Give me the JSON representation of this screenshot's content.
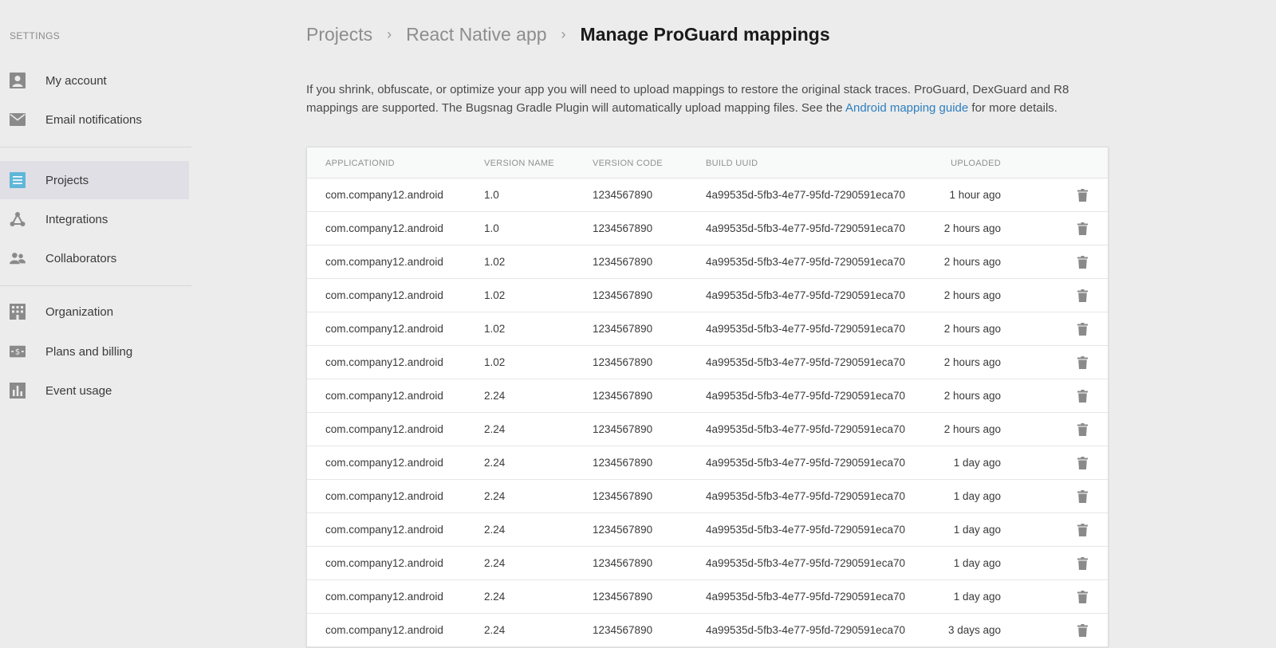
{
  "sidebar": {
    "heading": "SETTINGS",
    "items": [
      {
        "label": "My account",
        "icon": "person-icon"
      },
      {
        "label": "Email notifications",
        "icon": "envelope-icon"
      },
      {
        "label": "Projects",
        "icon": "list-icon",
        "active": true
      },
      {
        "label": "Integrations",
        "icon": "network-icon"
      },
      {
        "label": "Collaborators",
        "icon": "people-icon"
      },
      {
        "label": "Organization",
        "icon": "building-icon"
      },
      {
        "label": "Plans and billing",
        "icon": "billing-icon"
      },
      {
        "label": "Event usage",
        "icon": "bar-chart-icon"
      }
    ]
  },
  "breadcrumb": {
    "items": [
      "Projects",
      "React Native app"
    ],
    "current": "Manage ProGuard mappings"
  },
  "description": {
    "text_before": "If you shrink, obfuscate, or optimize your app you will need to upload mappings to restore the original stack traces. ProGuard, DexGuard and R8 mappings are supported. The Bugsnag Gradle Plugin will automatically upload mapping files. See the ",
    "link": "Android mapping guide",
    "text_after": " for more details."
  },
  "table": {
    "headers": {
      "application_id": "APPLICATIONID",
      "version_name": "VERSION NAME",
      "version_code": "VERSION CODE",
      "build_uuid": "BUILD UUID",
      "uploaded": "UPLOADED"
    },
    "rows": [
      {
        "application_id": "com.company12.android",
        "version_name": "1.0",
        "version_code": "1234567890",
        "build_uuid": "4a99535d-5fb3-4e77-95fd-7290591eca70",
        "uploaded": "1 hour ago"
      },
      {
        "application_id": "com.company12.android",
        "version_name": "1.0",
        "version_code": "1234567890",
        "build_uuid": "4a99535d-5fb3-4e77-95fd-7290591eca70",
        "uploaded": "2 hours ago"
      },
      {
        "application_id": "com.company12.android",
        "version_name": "1.02",
        "version_code": "1234567890",
        "build_uuid": "4a99535d-5fb3-4e77-95fd-7290591eca70",
        "uploaded": "2 hours ago"
      },
      {
        "application_id": "com.company12.android",
        "version_name": "1.02",
        "version_code": "1234567890",
        "build_uuid": "4a99535d-5fb3-4e77-95fd-7290591eca70",
        "uploaded": "2 hours ago"
      },
      {
        "application_id": "com.company12.android",
        "version_name": "1.02",
        "version_code": "1234567890",
        "build_uuid": "4a99535d-5fb3-4e77-95fd-7290591eca70",
        "uploaded": "2 hours ago"
      },
      {
        "application_id": "com.company12.android",
        "version_name": "1.02",
        "version_code": "1234567890",
        "build_uuid": "4a99535d-5fb3-4e77-95fd-7290591eca70",
        "uploaded": "2 hours ago"
      },
      {
        "application_id": "com.company12.android",
        "version_name": "2.24",
        "version_code": "1234567890",
        "build_uuid": "4a99535d-5fb3-4e77-95fd-7290591eca70",
        "uploaded": "2 hours ago"
      },
      {
        "application_id": "com.company12.android",
        "version_name": "2.24",
        "version_code": "1234567890",
        "build_uuid": "4a99535d-5fb3-4e77-95fd-7290591eca70",
        "uploaded": "2 hours ago"
      },
      {
        "application_id": "com.company12.android",
        "version_name": "2.24",
        "version_code": "1234567890",
        "build_uuid": "4a99535d-5fb3-4e77-95fd-7290591eca70",
        "uploaded": "1 day ago"
      },
      {
        "application_id": "com.company12.android",
        "version_name": "2.24",
        "version_code": "1234567890",
        "build_uuid": "4a99535d-5fb3-4e77-95fd-7290591eca70",
        "uploaded": "1 day ago"
      },
      {
        "application_id": "com.company12.android",
        "version_name": "2.24",
        "version_code": "1234567890",
        "build_uuid": "4a99535d-5fb3-4e77-95fd-7290591eca70",
        "uploaded": "1 day ago"
      },
      {
        "application_id": "com.company12.android",
        "version_name": "2.24",
        "version_code": "1234567890",
        "build_uuid": "4a99535d-5fb3-4e77-95fd-7290591eca70",
        "uploaded": "1 day ago"
      },
      {
        "application_id": "com.company12.android",
        "version_name": "2.24",
        "version_code": "1234567890",
        "build_uuid": "4a99535d-5fb3-4e77-95fd-7290591eca70",
        "uploaded": "1 day ago"
      },
      {
        "application_id": "com.company12.android",
        "version_name": "2.24",
        "version_code": "1234567890",
        "build_uuid": "4a99535d-5fb3-4e77-95fd-7290591eca70",
        "uploaded": "3 days ago"
      }
    ]
  },
  "colors": {
    "accent": "#5fb7d8",
    "link": "#2d7fc0",
    "icon": "#8a8a8a"
  }
}
